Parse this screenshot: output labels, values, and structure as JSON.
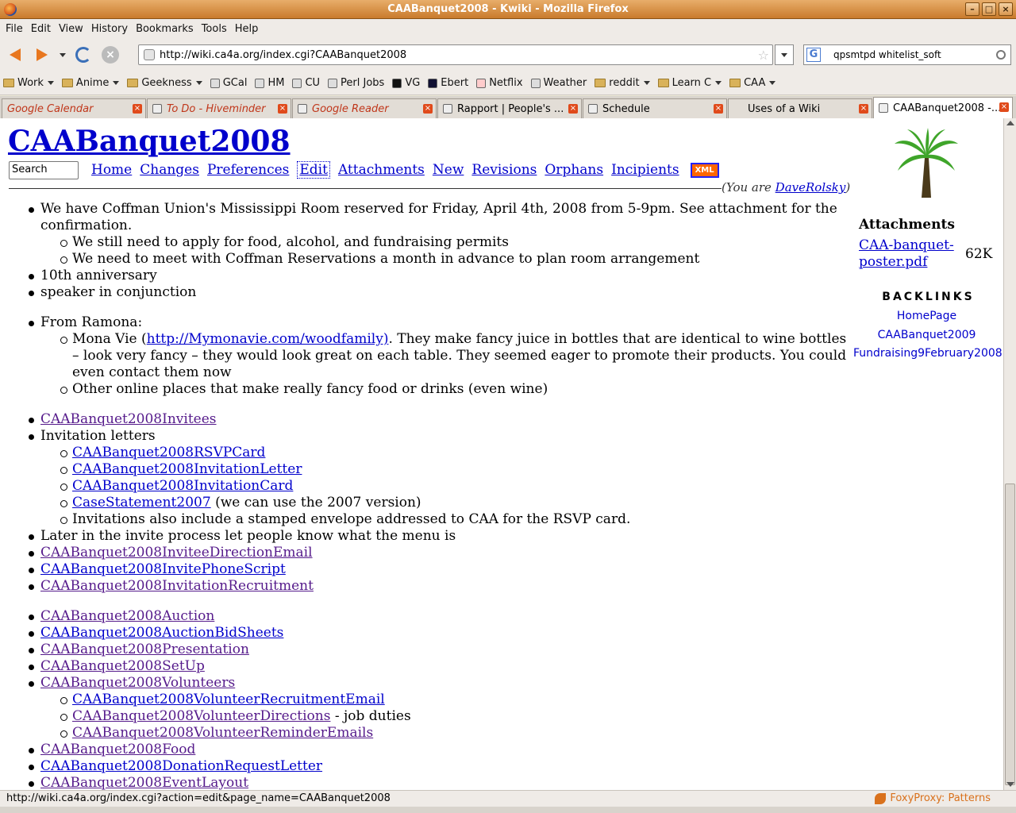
{
  "window": {
    "title": "CAABanquet2008 - Kwiki - Mozilla Firefox"
  },
  "menus": [
    {
      "label": "File"
    },
    {
      "label": "Edit"
    },
    {
      "label": "View"
    },
    {
      "label": "History"
    },
    {
      "label": "Bookmarks"
    },
    {
      "label": "Tools"
    },
    {
      "label": "Help"
    }
  ],
  "navbar": {
    "url": "http://wiki.ca4a.org/index.cgi?CAABanquet2008",
    "search_value": "qpsmtpd whitelist_soft"
  },
  "bookmarks": [
    {
      "label": "Work",
      "type": "folder"
    },
    {
      "label": "Anime",
      "type": "folder"
    },
    {
      "label": "Geekness",
      "type": "folder"
    },
    {
      "label": "GCal",
      "type": "link"
    },
    {
      "label": "HM",
      "type": "link"
    },
    {
      "label": "CU",
      "type": "link"
    },
    {
      "label": "Perl Jobs",
      "type": "link"
    },
    {
      "label": "VG",
      "type": "link"
    },
    {
      "label": "Ebert",
      "type": "link"
    },
    {
      "label": "Netflix",
      "type": "link"
    },
    {
      "label": "Weather",
      "type": "link"
    },
    {
      "label": "reddit",
      "type": "folder"
    },
    {
      "label": "Learn C",
      "type": "folder"
    },
    {
      "label": "CAA",
      "type": "folder"
    }
  ],
  "tabs": [
    {
      "label": "Google Calendar",
      "loading": true
    },
    {
      "label": "To Do - Hiveminder",
      "loading": true
    },
    {
      "label": "Google Reader",
      "loading": true
    },
    {
      "label": "Rapport | People's ...",
      "loading": false
    },
    {
      "label": "Schedule",
      "loading": false
    },
    {
      "label": "Uses of a Wiki",
      "loading": false
    },
    {
      "label": "CAABanquet2008 -...",
      "loading": false,
      "active": true
    }
  ],
  "wiki": {
    "title": "CAABanquet2008",
    "search_placeholder": "Search",
    "nav": [
      "Home",
      "Changes",
      "Preferences",
      "Edit",
      "Attachments",
      "New",
      "Revisions",
      "Orphans",
      "Incipients"
    ],
    "xml_badge": "XML",
    "you_are_prefix": "(You are ",
    "user": "DaveRolsky",
    "you_are_suffix": ")",
    "body": {
      "b1": "We have Coffman Union's Mississippi Room reserved for Friday, April 4th, 2008 from 5-9pm. See attachment for the confirmation.",
      "b1a": "We still need to apply for food, alcohol, and fundraising permits",
      "b1b": "We need to meet with Coffman Reservations a month in advance to plan room arrangement",
      "b2": "10th anniversary",
      "b3": "speaker in conjunction",
      "b4": "From Ramona:",
      "b4a_pre": "Mona Vie (",
      "b4a_link": "http://Mymonavie.com/woodfamily)",
      "b4a_post": ". They make fancy juice in bottles that are identical to wine bottles – look very fancy – they would look great on each table. They seemed eager to promote their products. You could even contact them now",
      "b4b": "Other online places that make really fancy food or drinks (even wine)",
      "invitees": "CAABanquet2008Invitees",
      "invitation_letters": "Invitation letters",
      "rsvp": "CAABanquet2008RSVPCard",
      "inv_letter": "CAABanquet2008InvitationLetter",
      "inv_card": "CAABanquet2008InvitationCard",
      "case_stmt": "CaseStatement2007",
      "case_stmt_post": " (we can use the 2007 version)",
      "envelope": "Invitations also include a stamped envelope addressed to CAA for the RSVP card.",
      "later": "Later in the invite process let people know what the menu is",
      "dir_email": "CAABanquet2008InviteeDirectionEmail",
      "phone": "CAABanquet2008InvitePhoneScript",
      "recruit": "CAABanquet2008InvitationRecruitment",
      "auction": "CAABanquet2008Auction",
      "bid": "CAABanquet2008AuctionBidSheets",
      "presentation": "CAABanquet2008Presentation",
      "setup": "CAABanquet2008SetUp",
      "volunteers": "CAABanquet2008Volunteers",
      "vol_email": "CAABanquet2008VolunteerRecruitmentEmail",
      "vol_dir": "CAABanquet2008VolunteerDirections",
      "vol_dir_post": " - job duties",
      "vol_rem": "CAABanquet2008VolunteerReminderEmails",
      "food": "CAABanquet2008Food",
      "donation": "CAABanquet2008DonationRequestLetter",
      "layout": "CAABanquet2008EventLayout"
    },
    "sidebar": {
      "attachments_title": "Attachments",
      "attachment_link": "CAA-banquet-poster.pdf",
      "attachment_size": "62K",
      "backlinks_title": "BACKLINKS",
      "backlinks": [
        "HomePage",
        "CAABanquet2009",
        "Fundraising9February2008"
      ]
    }
  },
  "status": {
    "text": "http://wiki.ca4a.org/index.cgi?action=edit&page_name=CAABanquet2008",
    "foxyproxy": "FoxyProxy: Patterns"
  }
}
